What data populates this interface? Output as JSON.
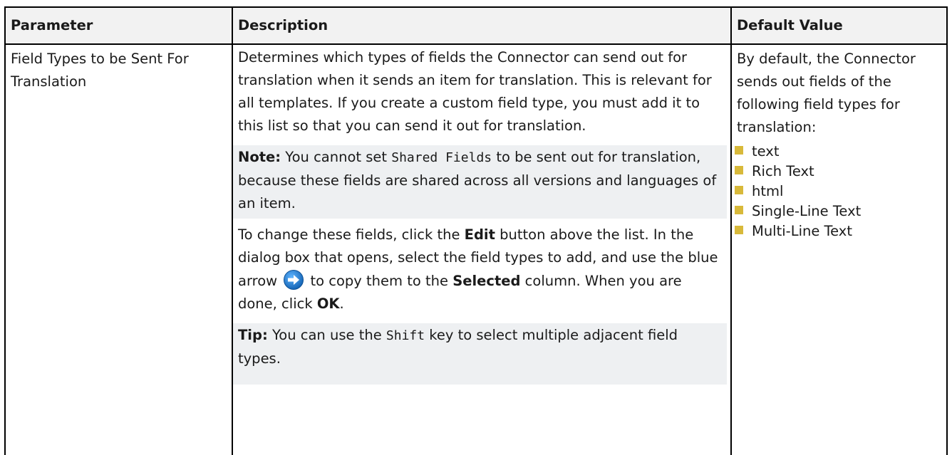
{
  "headers": {
    "parameter": "Parameter",
    "description": "Description",
    "default_value": "Default Value"
  },
  "row": {
    "parameter": "Field Types to be Sent For Translation",
    "desc_intro": "Determines which types of fields the Connector can send out for translation when it sends an item for translation. This is relevant for all templates. If you create a custom field type, you must add it to this list so that you can send it out for translation.",
    "note": {
      "label": "Note:",
      "text_before": " You cannot set ",
      "code": "Shared Fields",
      "text_after": " to be sent out for translation, because these fields are shared across all versions and languages of an item."
    },
    "instructions": {
      "t1": "To change these fields, click the ",
      "edit": "Edit",
      "t2": " button above the list. In the dialog box that opens, select the field types to add, and use the blue arrow ",
      "t3": " to copy them to the ",
      "selected": "Selected",
      "t4": " column. When you are done, click ",
      "ok": "OK",
      "t5": "."
    },
    "tip": {
      "label": "Tip:",
      "text_before": " You can use the ",
      "code": "Shift",
      "text_after": " key to select multiple adjacent field types."
    },
    "default_intro": "By default, the Connector sends out fields of the following field types for translation:",
    "default_items": [
      "text",
      "Rich Text",
      "html",
      "Single-Line Text",
      "Multi-Line Text"
    ]
  },
  "colors": {
    "header_bg": "#f2f2f2",
    "shaded_block_bg": "#eef0f2",
    "bullet": "#d8b93a",
    "arrow_icon": "#1a78c8"
  },
  "icons": {
    "arrow": "blue-right-arrow-icon"
  }
}
